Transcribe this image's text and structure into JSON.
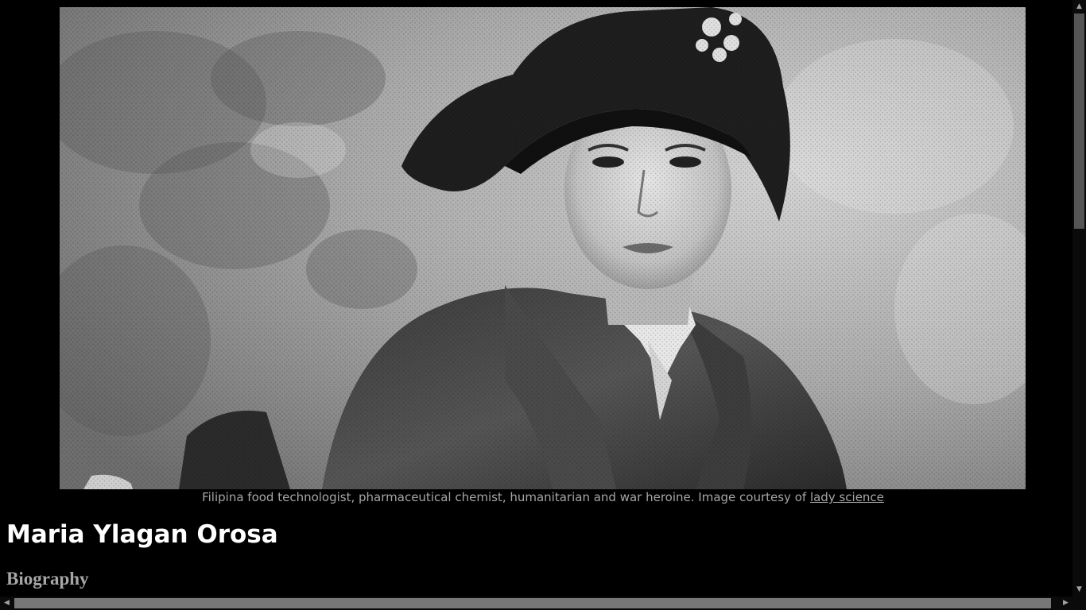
{
  "figure": {
    "image_alt": "Portrait photograph of Maria Ylagan Orosa",
    "caption_text": "Filipina food technologist, pharmaceutical chemist, humanitarian and war heroine. Image courtesy of ",
    "caption_link": "lady science"
  },
  "article": {
    "title": "Maria Ylagan Orosa",
    "section_heading": "Biography"
  },
  "scrollbars": {
    "up_icon": "▲",
    "down_icon": "▼",
    "left_icon": "◀",
    "right_icon": "▶"
  },
  "colors": {
    "background": "#000000",
    "caption": "#a6a6a6",
    "title": "#ffffff"
  }
}
